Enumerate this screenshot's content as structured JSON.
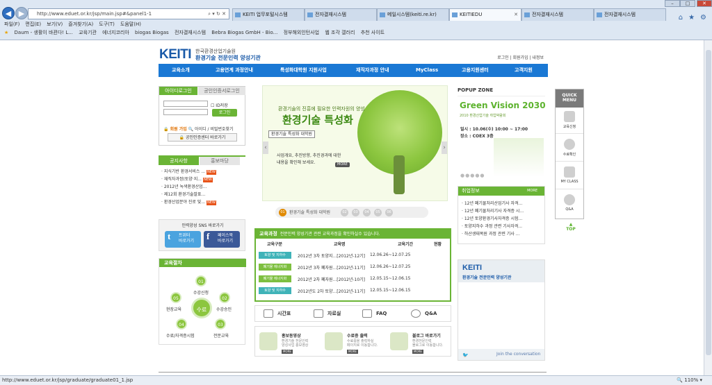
{
  "browser": {
    "address": "http://www.eduet.or.kr/jsp/main.jsp#&panel1-1",
    "tabs": [
      "KEITI 업무포털시스템",
      "전자결재시스템",
      "메일시스템(keiti.re.kr)",
      "KEITIEDU",
      "전자결재시스템",
      "전자결재시스템"
    ],
    "active_tab": 3,
    "menu": [
      "파일(F)",
      "편집(E)",
      "보기(V)",
      "즐겨찾기(A)",
      "도구(T)",
      "도움말(H)"
    ],
    "favorites": [
      "Daum - 생활이 바뀐다! L...",
      "교육기관",
      "에너지코리아",
      "biogas Biogas",
      "전자결재시스템",
      "Bebra Biogas GmbH - Bio...",
      "정부해외인턴사업",
      "웹 조각 갤러리",
      "추천 사이트"
    ],
    "status_url": "http://www.eduet.or.kr/jsp/graduate/graduate01_1.jsp",
    "zoom": "110%"
  },
  "site": {
    "logo_letters": "KEITI",
    "logo_line1": "한국환경산업기술원",
    "logo_line2": "환경기술 전문인력 양성기관",
    "top_links": "로그인  |  회원가입  |  내정보",
    "gnb": [
      "교육소개",
      "고용연계 과정안내",
      "특성화대학원 지원사업",
      "재직자과정 안내",
      "MyClass",
      "고용지원센터",
      "고객지원"
    ]
  },
  "login": {
    "tab_id": "아이디로그인",
    "tab_cert": "공인인증서로그인",
    "save_id": "ID저장",
    "login_btn": "로그인",
    "join": "회원 가입",
    "find": "아이디 / 비밀번호찾기",
    "cert_center": "공인인증센터 바로가기"
  },
  "notice": {
    "tab_notice": "공지사항",
    "tab_promo": "홍보마당",
    "items": [
      "지식기반 환경서비스 ...",
      "재직자과정(토양·지...",
      "2012년 녹색환경산업...",
      "제12회 환경기술발표...",
      "환경산업분야 진로 및..."
    ],
    "new_badge": "NEW"
  },
  "sns": {
    "title": "인력양성 SNS 바로가기",
    "twitter": "트위터\n바로가기",
    "facebook": "페이스북\n바로가기"
  },
  "steps": {
    "title": "교육절차",
    "center": "수료",
    "items": [
      {
        "no": "01",
        "label": "수강신청"
      },
      {
        "no": "02",
        "label": "수강승인"
      },
      {
        "no": "03",
        "label": "전문교육"
      },
      {
        "no": "04",
        "label": "수료/자격증시험"
      },
      {
        "no": "05",
        "label": "현장교육"
      }
    ]
  },
  "banner": {
    "sub": "환경기술의 진흥에 필요한 인력자원의 양성",
    "title": "환경기술 특성화",
    "caption": "환경기술 특성화 대학원",
    "desc_line1": "사업개요, 추진방향, 추진경과에 대한",
    "desc_line2": "내용을 확인해 보세요.",
    "more": "MORE",
    "nav_label": "환경기술 특성화 대학원",
    "nav_numbers": [
      "01",
      "02",
      "03",
      "04",
      "05",
      "06"
    ]
  },
  "courses": {
    "title": "교육과정",
    "subtitle": "전문인력 양성기관 관련 교육과정을 확인하실수 있습니다.",
    "columns": [
      "교육구분",
      "교육명",
      "교육기간",
      "현황"
    ],
    "rows": [
      {
        "type": "토양 및 지하수",
        "name": "2012년 3차 토양지...[2012년-12기]",
        "period": "12.06.26~12.07.25",
        "teal": true
      },
      {
        "type": "폐기물 에너지화",
        "name": "2012년 3차 폐자원...[2012년-11기]",
        "period": "12.06.26~12.07.25",
        "teal": false
      },
      {
        "type": "폐기물 에너지화",
        "name": "2012년 2차 폐자원...[2012년-10기]",
        "period": "12.05.15~12.06.15",
        "teal": false
      },
      {
        "type": "토양 및 지하수",
        "name": "2012년도 2차 토양...[2012년-11기]",
        "period": "12.05.15~12.06.15",
        "teal": true
      }
    ]
  },
  "quick_links": [
    "시간표",
    "자료실",
    "FAQ",
    "Q&A"
  ],
  "quick_boxes": [
    {
      "title": "홍보동영상",
      "desc": "환경기술 전문인력\n양성사업 홍보영상",
      "more": "MORE"
    },
    {
      "title": "수료증 출력",
      "desc": "수료증을 출력하실\n페이지로 이동합니다.",
      "more": "MORE"
    },
    {
      "title": "블로그 바로가기",
      "desc": "환경전문인력\n블로그로 이동합니다.",
      "more": "MORE"
    }
  ],
  "popup": {
    "title": "POPUP ZONE",
    "headline": "Green Vision 2030",
    "tagline": "2010 환경산업기술 취업박람회",
    "date": "일시 : 10.06(수) 10:00 ~ 17:00",
    "place": "장소 : COEX 3층",
    "dots": "●●●●●"
  },
  "jobs": {
    "title": "취업정보",
    "more": "MORE",
    "items": [
      "12년 폐기물처리산업기사 자격...",
      "12년 폐기물처리기사 자격증 시...",
      "12년 토양환경기사자격증 시험...",
      "토양지하수 과정 관련 기사자격...",
      "하산생태복원 과정 관련 기사 ..."
    ]
  },
  "keiti_box": {
    "logo": "KEITI",
    "sub": "환경기술 전문인력 양성기관",
    "footer": "Join the conversation"
  },
  "quick_menu": {
    "title": "QUICK\nMENU",
    "items": [
      "교육신청",
      "수료확인",
      "MY CLASS",
      "Q&A"
    ],
    "top": "TOP"
  }
}
